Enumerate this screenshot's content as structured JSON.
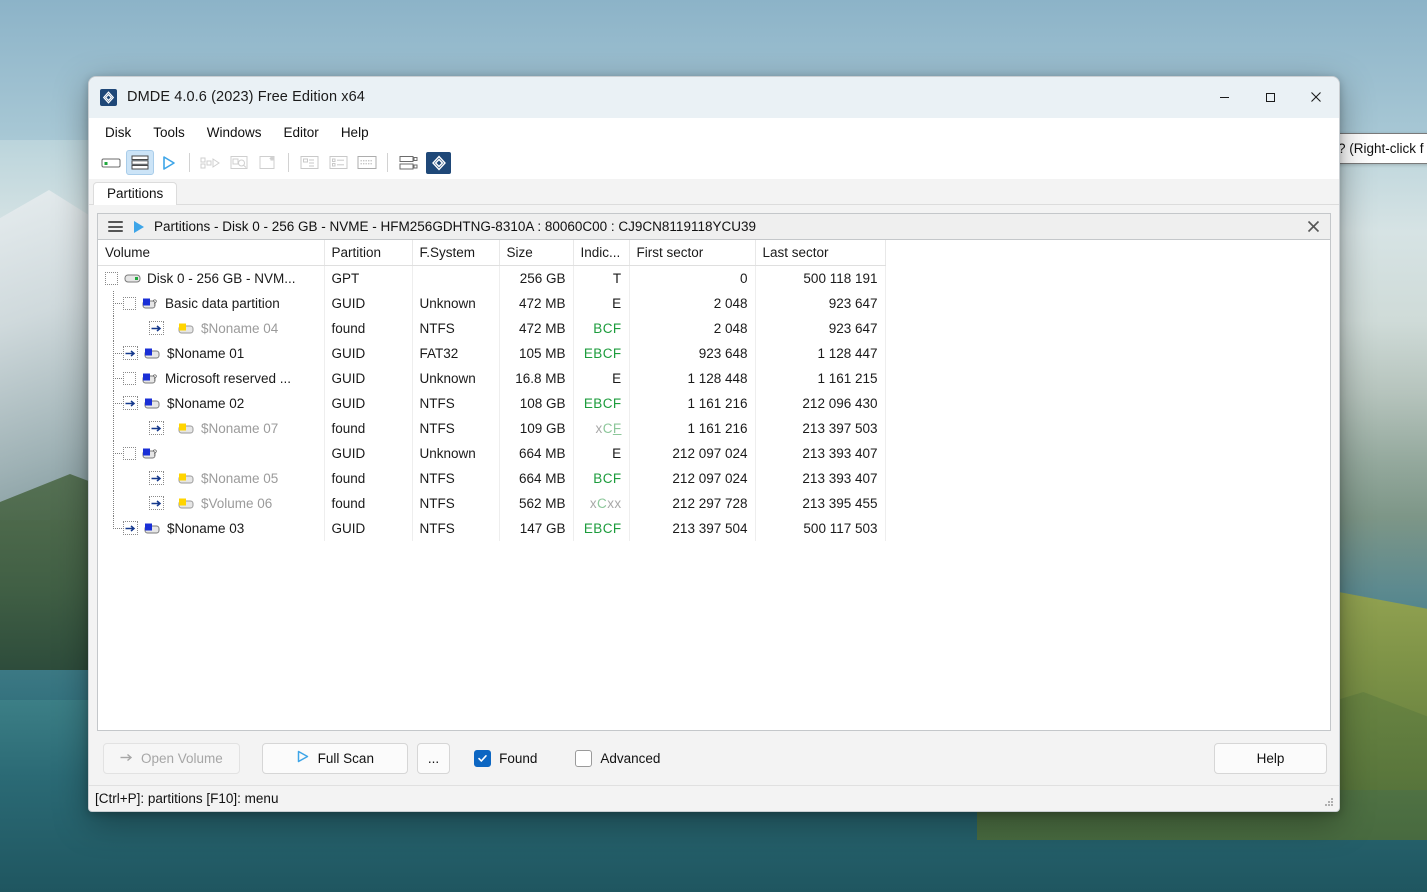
{
  "window": {
    "title": "DMDE 4.0.6 (2023) Free Edition x64",
    "app_icon": "dmde-logo-icon",
    "minimize": "–",
    "maximize": "□",
    "close": "✕"
  },
  "menubar": {
    "items": [
      {
        "label": "Disk"
      },
      {
        "label": "Tools"
      },
      {
        "label": "Windows"
      },
      {
        "label": "Editor"
      },
      {
        "label": "Help"
      }
    ]
  },
  "toolbar": {
    "buttons": [
      {
        "name": "drive-view-icon",
        "state": "enabled"
      },
      {
        "name": "partitions-view-icon",
        "state": "active"
      },
      {
        "name": "open-volume-icon",
        "state": "enabled"
      },
      {
        "name": "sector-map-icon",
        "state": "disabled"
      },
      {
        "name": "search-sector-icon",
        "state": "disabled"
      },
      {
        "name": "new-scan-icon",
        "state": "disabled"
      },
      {
        "name": "tree-view-icon",
        "state": "disabled"
      },
      {
        "name": "list-view-icon",
        "state": "disabled"
      },
      {
        "name": "hex-view-icon",
        "state": "disabled"
      },
      {
        "name": "clone-copy-icon",
        "state": "enabled"
      },
      {
        "name": "dmde-brand-icon",
        "state": "accent"
      }
    ]
  },
  "tabs": [
    {
      "label": "Partitions",
      "active": true
    }
  ],
  "document": {
    "menu_icon": "hamburger-icon",
    "run_icon": "play-icon",
    "title": "Partitions - Disk 0 - 256 GB - NVME - HFM256GDHTNG-8310A : 80060C00 : CJ9CN8119118YCU39",
    "close_icon": "✕"
  },
  "table": {
    "columns": [
      {
        "key": "volume",
        "label": "Volume",
        "align": "left"
      },
      {
        "key": "partition",
        "label": "Partition",
        "align": "left"
      },
      {
        "key": "fsystem",
        "label": "F.System",
        "align": "left"
      },
      {
        "key": "size",
        "label": "Size",
        "align": "right"
      },
      {
        "key": "indic",
        "label": "Indic...",
        "align": "left"
      },
      {
        "key": "first_sector",
        "label": "First sector",
        "align": "right"
      },
      {
        "key": "last_sector",
        "label": "Last sector",
        "align": "right"
      }
    ],
    "rows": [
      {
        "volume": "Disk 0 - 256 GB - NVM...",
        "partition": "GPT",
        "fsystem": "",
        "size": "256 GB",
        "indic": "T",
        "indic_colors": [
          "k"
        ],
        "first_sector": "0",
        "last_sector": "500 118 191",
        "depth": 0,
        "marker": "checkbox",
        "icon": "disk-icon",
        "dim": false,
        "partition_dim": true
      },
      {
        "volume": "Basic data partition",
        "partition": "GUID",
        "fsystem": "Unknown",
        "size": "472 MB",
        "indic": "E",
        "indic_colors": [
          "k"
        ],
        "first_sector": "2 048",
        "last_sector": "923 647",
        "depth": 1,
        "marker": "checkbox",
        "icon": "partition-unknown-icon",
        "dim": false
      },
      {
        "volume": "$Noname 04",
        "partition": "found",
        "fsystem": "NTFS",
        "size": "472 MB",
        "indic": "BCF",
        "indic_colors": [
          "g",
          "g",
          "g"
        ],
        "first_sector": "2 048",
        "last_sector": "923 647",
        "depth": 2,
        "marker": "arrow",
        "icon": "volume-found-icon",
        "dim": true
      },
      {
        "volume": "$Noname 01",
        "partition": "GUID",
        "fsystem": "FAT32",
        "size": "105 MB",
        "indic": "EBCF",
        "indic_colors": [
          "g",
          "g",
          "g",
          "g"
        ],
        "first_sector": "923 648",
        "last_sector": "1 128 447",
        "depth": 1,
        "marker": "arrow",
        "icon": "partition-icon",
        "dim": false
      },
      {
        "volume": "Microsoft reserved ...",
        "partition": "GUID",
        "fsystem": "Unknown",
        "size": "16.8 MB",
        "indic": "E",
        "indic_colors": [
          "k"
        ],
        "first_sector": "1 128 448",
        "last_sector": "1 161 215",
        "depth": 1,
        "marker": "checkbox",
        "icon": "partition-unknown-icon",
        "dim": false
      },
      {
        "volume": "$Noname 02",
        "partition": "GUID",
        "fsystem": "NTFS",
        "size": "108 GB",
        "indic": "EBCF",
        "indic_colors": [
          "g",
          "g",
          "g",
          "g"
        ],
        "first_sector": "1 161 216",
        "last_sector": "212 096 430",
        "depth": 1,
        "marker": "arrow",
        "icon": "partition-icon",
        "dim": false
      },
      {
        "volume": "$Noname 07",
        "partition": "found",
        "fsystem": "NTFS",
        "size": "109 GB",
        "indic": "xCF",
        "indic_colors": [
          "kd",
          "gd",
          "gdu"
        ],
        "first_sector": "1 161 216",
        "last_sector": "213 397 503",
        "depth": 2,
        "marker": "arrow",
        "icon": "volume-found-icon",
        "dim": true
      },
      {
        "volume": "",
        "partition": "GUID",
        "fsystem": "Unknown",
        "size": "664 MB",
        "indic": "E",
        "indic_colors": [
          "k"
        ],
        "first_sector": "212 097 024",
        "last_sector": "213 393 407",
        "depth": 1,
        "marker": "checkbox",
        "icon": "partition-unknown-icon",
        "dim": false
      },
      {
        "volume": "$Noname 05",
        "partition": "found",
        "fsystem": "NTFS",
        "size": "664 MB",
        "indic": "BCF",
        "indic_colors": [
          "g",
          "g",
          "g"
        ],
        "first_sector": "212 097 024",
        "last_sector": "213 393 407",
        "depth": 2,
        "marker": "arrow",
        "icon": "volume-found-icon",
        "dim": true
      },
      {
        "volume": "$Volume 06",
        "partition": "found",
        "fsystem": "NTFS",
        "size": "562 MB",
        "indic": "xCxx",
        "indic_colors": [
          "kd",
          "gd",
          "kd",
          "kd"
        ],
        "first_sector": "212 297 728",
        "last_sector": "213 395 455",
        "depth": 2,
        "marker": "arrow",
        "icon": "volume-found-icon",
        "dim": true
      },
      {
        "volume": "$Noname 03",
        "partition": "GUID",
        "fsystem": "NTFS",
        "size": "147 GB",
        "indic": "EBCF",
        "indic_colors": [
          "g",
          "g",
          "g",
          "g"
        ],
        "first_sector": "213 397 504",
        "last_sector": "500 117 503",
        "depth": 1,
        "marker": "arrow",
        "icon": "partition-icon",
        "dim": false,
        "last_child": true
      }
    ]
  },
  "bottombar": {
    "open_volume": {
      "label": "Open Volume",
      "icon": "arrow-right-icon",
      "disabled": true
    },
    "full_scan": {
      "label": "Full Scan",
      "icon": "play-icon"
    },
    "more": {
      "label": "..."
    },
    "found": {
      "label": "Found",
      "checked": true
    },
    "advanced": {
      "label": "Advanced",
      "checked": false
    },
    "help": {
      "label": "Help"
    }
  },
  "statusbar": {
    "text": "[Ctrl+P]: partitions  [F10]: menu"
  },
  "tooltip": {
    "text": "? (Right-click f"
  },
  "colors": {
    "accent": "#0c66c2",
    "brand": "#1f4878",
    "indicator_green": "#1c9c3c",
    "indicator_green_dim": "#8cc79a",
    "title_bar": "#eaf1f5",
    "window_bg": "#f3f3f3",
    "volume_yellow": "#ffd400",
    "partition_blue": "#1a2fd6"
  }
}
